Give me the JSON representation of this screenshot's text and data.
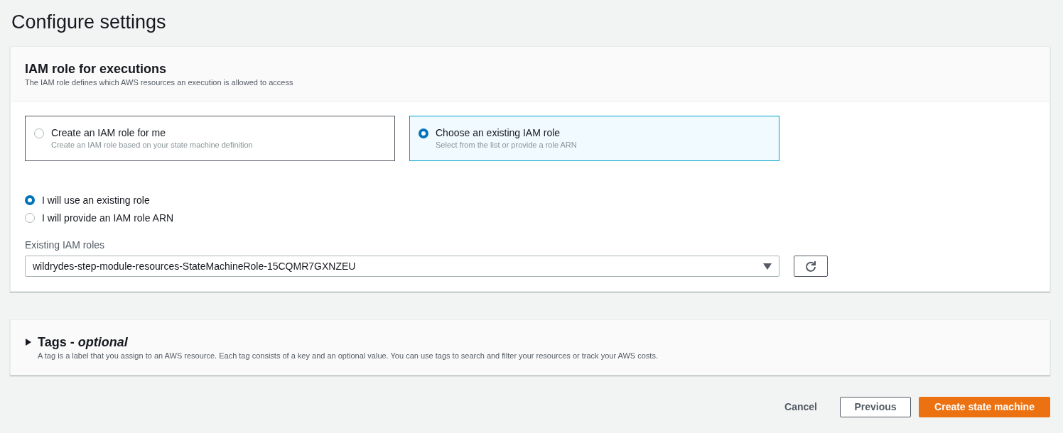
{
  "page_title": "Configure settings",
  "iam_panel": {
    "title": "IAM role for executions",
    "description": "The IAM role defines which AWS resources an execution is allowed to access",
    "role_options": [
      {
        "label": "Create an IAM role for me",
        "description": "Create an IAM role based on your state machine definition",
        "selected": false
      },
      {
        "label": "Choose an existing IAM role",
        "description": "Select from the list or provide a role ARN",
        "selected": true
      }
    ],
    "source_options": [
      {
        "label": "I will use an existing role",
        "selected": true
      },
      {
        "label": "I will provide an IAM role ARN",
        "selected": false
      }
    ],
    "roles_field": {
      "label": "Existing IAM roles",
      "value": "wildrydes-step-module-resources-StateMachineRole-15CQMR7GXNZEU"
    }
  },
  "tags_panel": {
    "title": "Tags - *optional*",
    "expanded": false,
    "description": "A tag is a label that you assign to an AWS resource. Each tag consists of a key and an optional value. You can use tags to search and filter your resources or track your AWS costs."
  },
  "actions": {
    "cancel": "Cancel",
    "previous": "Previous",
    "submit": "Create state machine"
  }
}
